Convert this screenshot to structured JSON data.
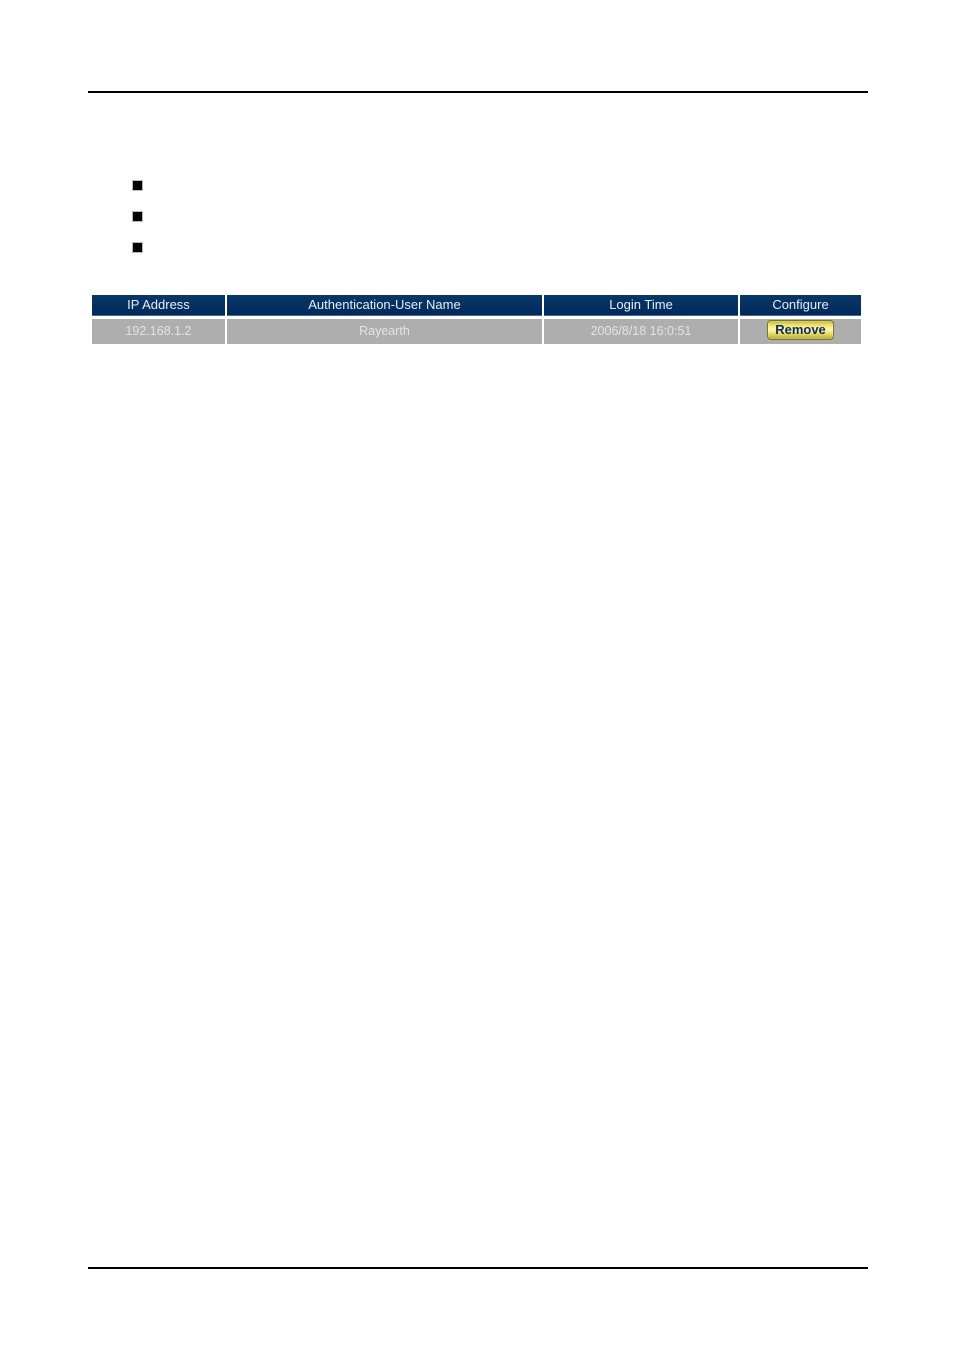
{
  "page": {
    "header_rule": "horizontal-rule",
    "footer_rule": "horizontal-rule"
  },
  "bullets": [
    {
      "marker": "black-square-bullet",
      "text": ""
    },
    {
      "marker": "black-square-bullet",
      "text": ""
    },
    {
      "marker": "black-square-bullet",
      "text": ""
    }
  ],
  "session_table": {
    "columns": [
      "IP Address",
      "Authentication-User Name",
      "Login Time",
      "Configure"
    ],
    "rows": [
      {
        "ip_address": "192.168.1.2",
        "user_name": "Rayearth",
        "login_time": "2006/8/18 16:0:51",
        "configure_label": "Remove"
      }
    ]
  },
  "colors": {
    "header_background": "#032f62",
    "header_text": "#e9edf3",
    "row_background": "#aeaeae",
    "row_text": "#e3e3e3",
    "button_text": "#102a63",
    "button_border": "#7e7420",
    "rule": "#000000"
  }
}
